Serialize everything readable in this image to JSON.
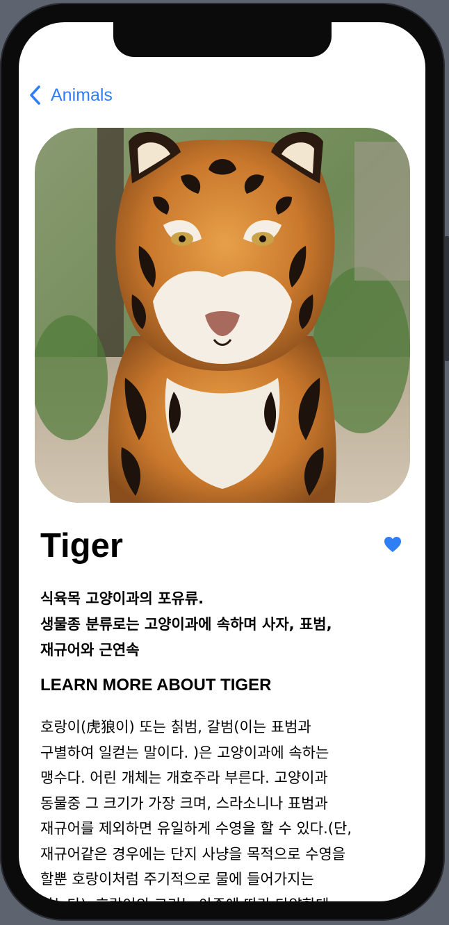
{
  "nav": {
    "back_label": "Animals"
  },
  "animal": {
    "name": "Tiger",
    "is_favorite": true,
    "summary_lines": [
      "식육목 고양이과의 포유류.",
      "생물종 분류로는 고양이과에 속하며 사자, 표범,",
      "재규어와 근연속"
    ],
    "learn_more_heading": "LEARN MORE ABOUT TIGER",
    "description_lines": [
      "호랑이(虎狼이) 또는 칡범, 갈범(이는 표범과",
      "구별하여 일컫는 말이다. )은 고양이과에 속하는",
      "맹수다. 어린 개체는 개호주라 부른다. 고양이과",
      "동물중 그 크기가 가장 크며, 스라소니나 표범과",
      "재규어를 제외하면 유일하게 수영을 할 수 있다.(단,",
      "재규어같은 경우에는 단지 사냥을 목적으로 수영을",
      "할뿐 호랑이처럼 주기적으로 물에 들어가지는",
      "않는다). 호랑이의 크기는 아종에 따라 다양한데,"
    ]
  },
  "colors": {
    "accent": "#2f7ef6",
    "text": "#000000",
    "background": "#ffffff"
  },
  "icons": {
    "back": "chevron-left-icon",
    "favorite": "heart-fill-icon"
  }
}
